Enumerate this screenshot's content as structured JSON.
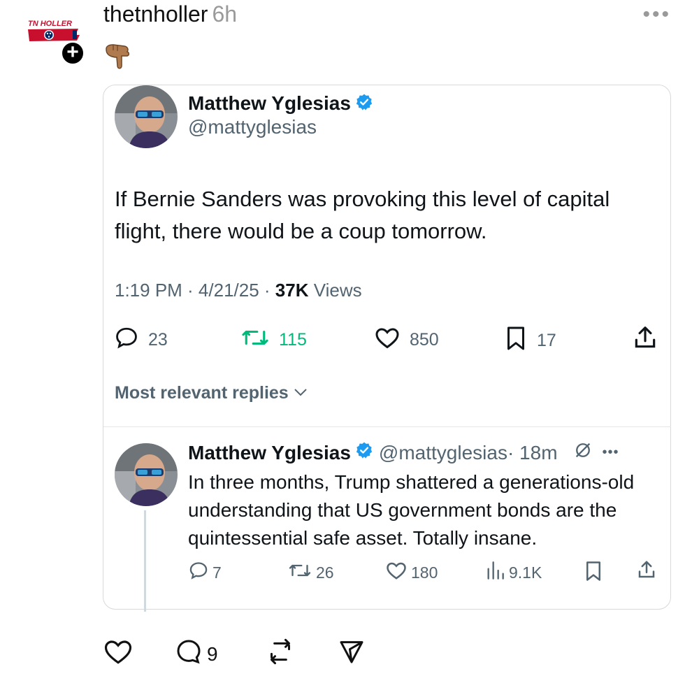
{
  "post": {
    "username": "thetnholler",
    "time_ago": "6h",
    "logo_text": "TN HOLLER",
    "more_label": "•••",
    "emoji": "👇🏽"
  },
  "embed": {
    "author_name": "Matthew Yglesias",
    "author_handle": "@mattyglesias",
    "text": "If Bernie Sanders was provoking this level of capital flight, there would be a coup tomorrow.",
    "timestamp": "1:19 PM · 4/21/25 · ",
    "views_count": "37K",
    "views_label": " Views",
    "stats": {
      "replies": "23",
      "reposts": "115",
      "likes": "850",
      "bookmarks": "17"
    },
    "relevant_label": "Most relevant replies",
    "reply": {
      "author_name": "Matthew Yglesias",
      "author_handle": "@mattyglesias",
      "time": " · 18m",
      "text": "In three months, Trump shattered a generations-old understanding that US government bonds are the quintessential safe asset. Totally insane.",
      "stats": {
        "replies": "7",
        "reposts": "26",
        "likes": "180",
        "views": "9.1K"
      }
    }
  },
  "bottom": {
    "comments": "9"
  },
  "colors": {
    "verified": "#1d9bf0",
    "repost": "#00ba7c",
    "muted": "#536471",
    "border": "#d9d9d9"
  }
}
